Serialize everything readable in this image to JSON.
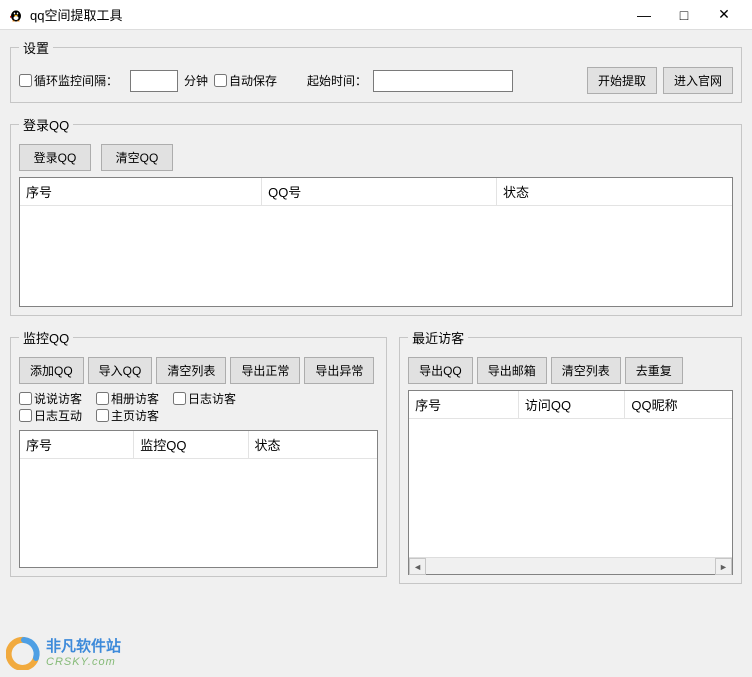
{
  "titlebar": {
    "title": "qq空间提取工具",
    "min": "—",
    "max": "□",
    "close": "✕"
  },
  "settings": {
    "legend": "设置",
    "loop_interval_label": "循环监控间隔：",
    "loop_interval_value": "",
    "minute_unit": "分钟",
    "auto_save_label": "自动保存",
    "start_time_label": "起始时间：",
    "start_time_value": "",
    "start_extract_btn": "开始提取",
    "enter_site_btn": "进入官网"
  },
  "login_qq": {
    "legend": "登录QQ",
    "login_btn": "登录QQ",
    "clear_btn": "清空QQ",
    "cols": [
      "序号",
      "QQ号",
      "状态"
    ]
  },
  "monitor_qq": {
    "legend": "监控QQ",
    "buttons": [
      "添加QQ",
      "导入QQ",
      "清空列表",
      "导出正常",
      "导出异常"
    ],
    "check_labels": [
      "说说访客",
      "相册访客",
      "日志访客",
      "日志互动",
      "主页访客"
    ],
    "cols": [
      "序号",
      "监控QQ",
      "状态"
    ]
  },
  "recent_visitor": {
    "legend": "最近访客",
    "buttons": [
      "导出QQ",
      "导出邮箱",
      "清空列表",
      "去重复"
    ],
    "cols": [
      "序号",
      "访问QQ",
      "QQ昵称"
    ]
  },
  "watermark": {
    "ch": "非凡软件站",
    "en": "CRSKY.com"
  }
}
